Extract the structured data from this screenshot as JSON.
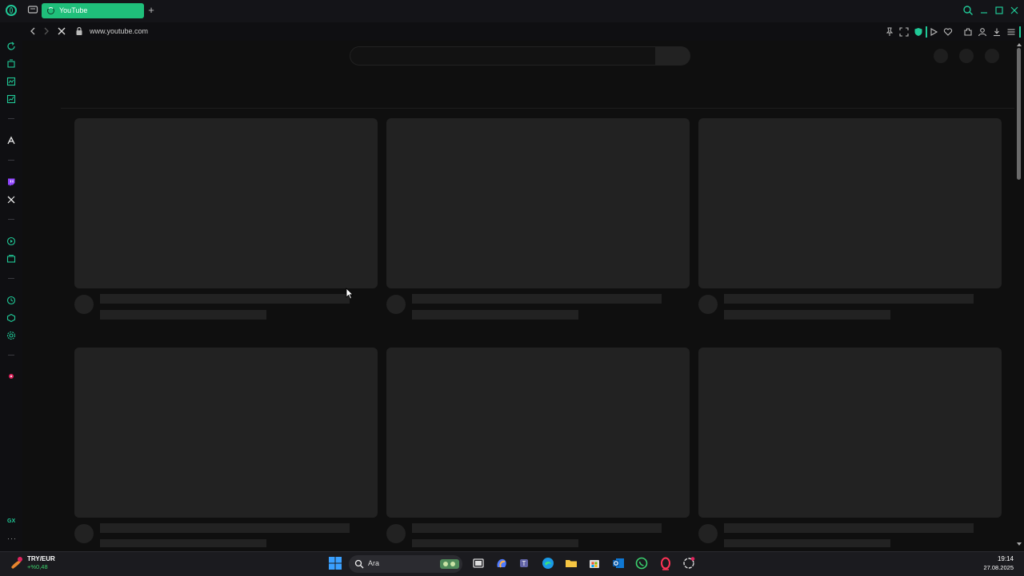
{
  "browser": {
    "active_tab": {
      "title": "YouTube",
      "loading": true
    },
    "new_tab_label": "+",
    "address": {
      "url": "www.youtube.com"
    }
  },
  "sidebar": {
    "bottom_label": "GX",
    "more_label": "···"
  },
  "taskbar": {
    "widget": {
      "label": "TRY/EUR",
      "value": "+%0,48"
    },
    "search_placeholder": "Ara",
    "clock": {
      "time": "19:14",
      "date": "27.08.2025"
    }
  },
  "colors": {
    "accent": "#20c997",
    "tab_active": "#1fbf7a",
    "page_bg": "#0f0f0f",
    "skeleton": "#222222"
  }
}
